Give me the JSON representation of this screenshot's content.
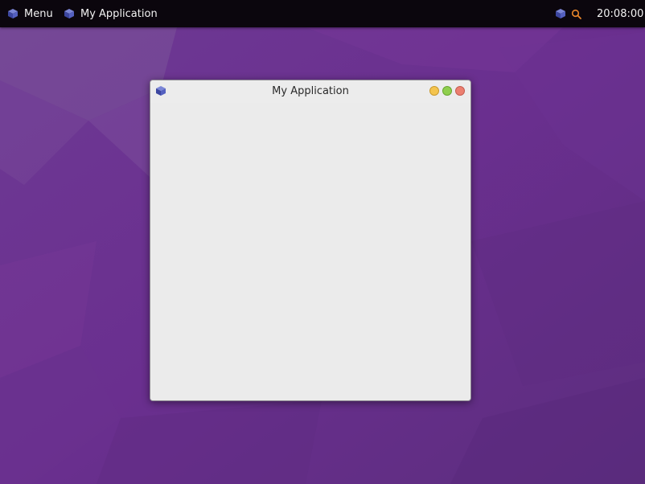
{
  "panel": {
    "menu_label": "Menu",
    "task_label": "My Application",
    "clock": "20:08:00",
    "tray_icons": [
      "app-cube-icon",
      "search-icon"
    ]
  },
  "window": {
    "title": "My Application",
    "controls": [
      "minimize",
      "maximize",
      "close"
    ]
  },
  "colors": {
    "panel_bg": "#0b060d",
    "wallpaper": "#6a3290",
    "window_bg": "#ebebeb",
    "minimize": "#f4c44e",
    "maximize": "#8fcf4e",
    "close": "#ec7f70",
    "search_icon": "#e8862a",
    "cube": "#4a56b8"
  }
}
